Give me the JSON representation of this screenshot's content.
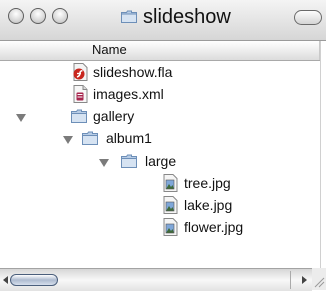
{
  "window": {
    "title": "slideshow",
    "column_header": "Name"
  },
  "files": [
    {
      "name": "slideshow.fla",
      "icon": "flash-file-icon"
    },
    {
      "name": "images.xml",
      "icon": "xml-file-icon"
    },
    {
      "name": "gallery",
      "icon": "folder-icon"
    },
    {
      "name": "album1",
      "icon": "folder-icon"
    },
    {
      "name": "large",
      "icon": "folder-icon"
    },
    {
      "name": "tree.jpg",
      "icon": "image-file-icon"
    },
    {
      "name": "lake.jpg",
      "icon": "image-file-icon"
    },
    {
      "name": "flower.jpg",
      "icon": "image-file-icon"
    }
  ],
  "colors": {
    "folder": "#8fb0d8",
    "disclosure": "#7b7b7b",
    "scroll_thumb": "#aebbd0"
  }
}
